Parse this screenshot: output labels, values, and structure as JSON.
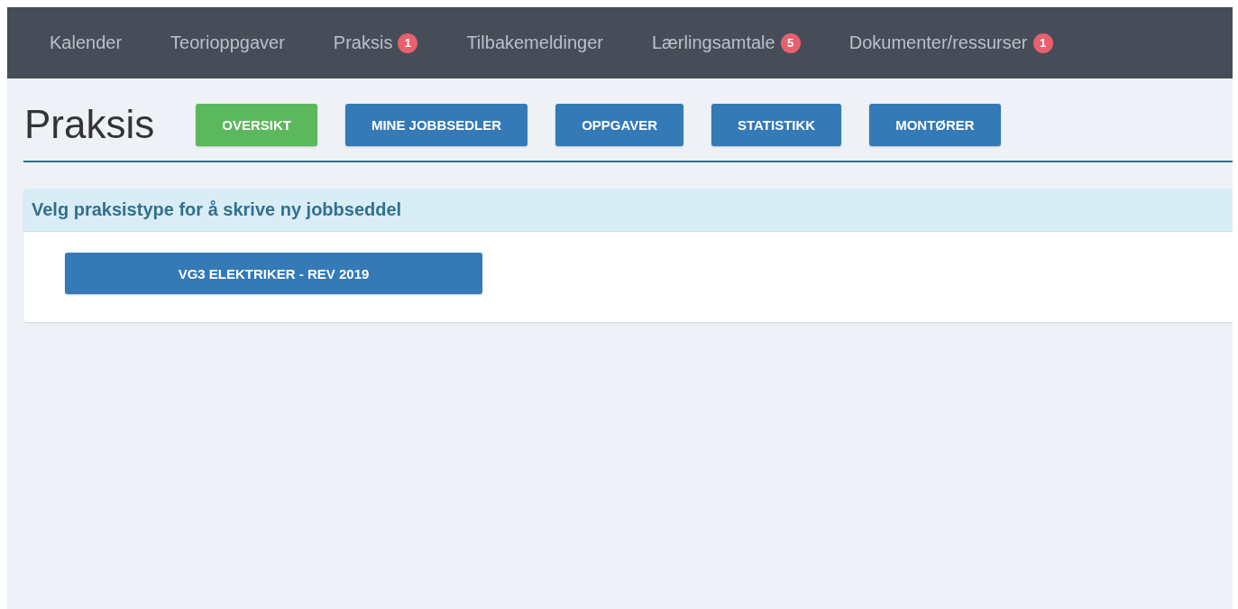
{
  "nav": [
    {
      "label": "Kalender"
    },
    {
      "label": "Teorioppgaver"
    },
    {
      "label": "Praksis",
      "badge": "1"
    },
    {
      "label": "Tilbakemeldinger"
    },
    {
      "label": "Lærlingsamtale",
      "badge": "5"
    },
    {
      "label": "Dokumenter/ressurser",
      "badge": "1"
    }
  ],
  "page_title": "Praksis",
  "tabs": [
    {
      "label": "OVERSIKT",
      "selected": true
    },
    {
      "label": "MINE JOBBSEDLER",
      "selected": false
    },
    {
      "label": "OPPGAVER",
      "selected": false
    },
    {
      "label": "STATISTIKK",
      "selected": false
    },
    {
      "label": "MONTØRER",
      "selected": false
    }
  ],
  "panel": {
    "heading": "Velg praksistype for å skrive ny jobbseddel",
    "buttons": [
      "VG3 ELEKTRIKER - REV 2019"
    ]
  }
}
